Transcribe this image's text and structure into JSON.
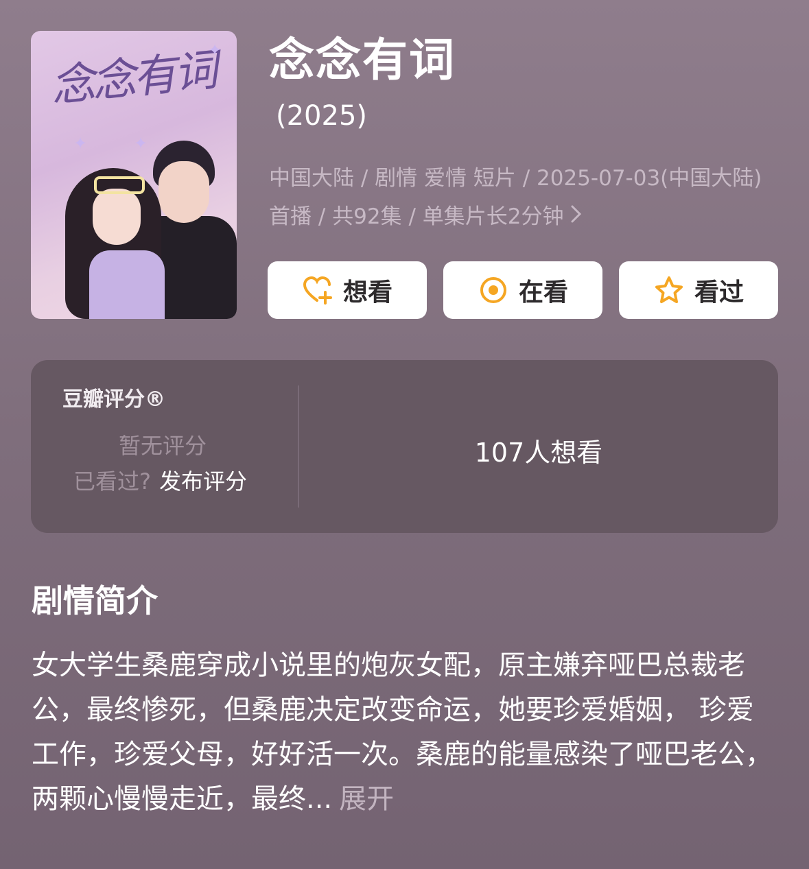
{
  "poster": {
    "title_text": "念念有词"
  },
  "header": {
    "title": "念念有词",
    "year": "(2025)",
    "meta": "中国大陆 / 剧情 爱情 短片 / 2025-07-03(中国大陆) 首播 / 共92集 / 单集片长2分钟"
  },
  "actions": {
    "want": "想看",
    "watching": "在看",
    "watched": "看过",
    "accent": "#f5a623"
  },
  "rating": {
    "title": "豆瓣评分®",
    "no_score": "暂无评分",
    "watched_prompt": "已看过?",
    "publish": "发布评分",
    "want_count": "107人想看"
  },
  "synopsis": {
    "title": "剧情简介",
    "text": "女大学生桑鹿穿成小说里的炮灰女配，原主嫌弃哑巴总裁老公，最终惨死，但桑鹿决定改变命运，她要珍爱婚姻， 珍爱工作，珍爱父母，好好活一次。桑鹿的能量感染了哑巴老公，两颗心慢慢走近，最终...",
    "expand": "展开"
  }
}
